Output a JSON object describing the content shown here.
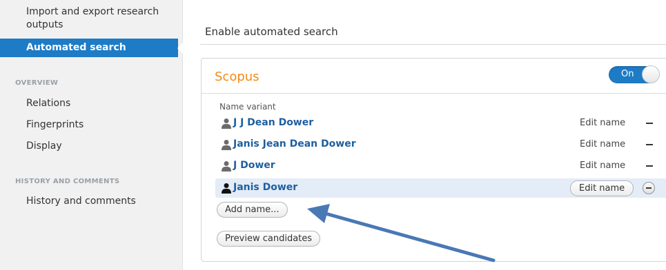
{
  "sidebar": {
    "link_import": "Import and export research",
    "link_import_2": "outputs",
    "active_item": "Automated search",
    "overview_heading": "OVERVIEW",
    "overview_items": [
      "Relations",
      "Fingerprints",
      "Display"
    ],
    "history_heading": "HISTORY AND COMMENTS",
    "history_items": [
      "History and comments"
    ]
  },
  "main": {
    "title": "Enable automated search",
    "panel": {
      "title": "Scopus",
      "toggle_label": "On",
      "name_variant_label": "Name variant",
      "rows": [
        {
          "name": "J J Dean Dower",
          "edit": "Edit name"
        },
        {
          "name": "Janis Jean Dean Dower",
          "edit": "Edit name"
        },
        {
          "name": "J Dower",
          "edit": "Edit name"
        },
        {
          "name": "Janis Dower",
          "edit": "Edit name"
        }
      ],
      "add_button": "Add name...",
      "preview_button": "Preview candidates"
    }
  },
  "colors": {
    "accent": "#1e7bc6",
    "title_orange": "#f08a16",
    "link_blue": "#1e5f9f",
    "annotation_arrow": "#4a78b5"
  },
  "icons": [
    "person-icon",
    "minus-icon",
    "arrow-annotation"
  ]
}
